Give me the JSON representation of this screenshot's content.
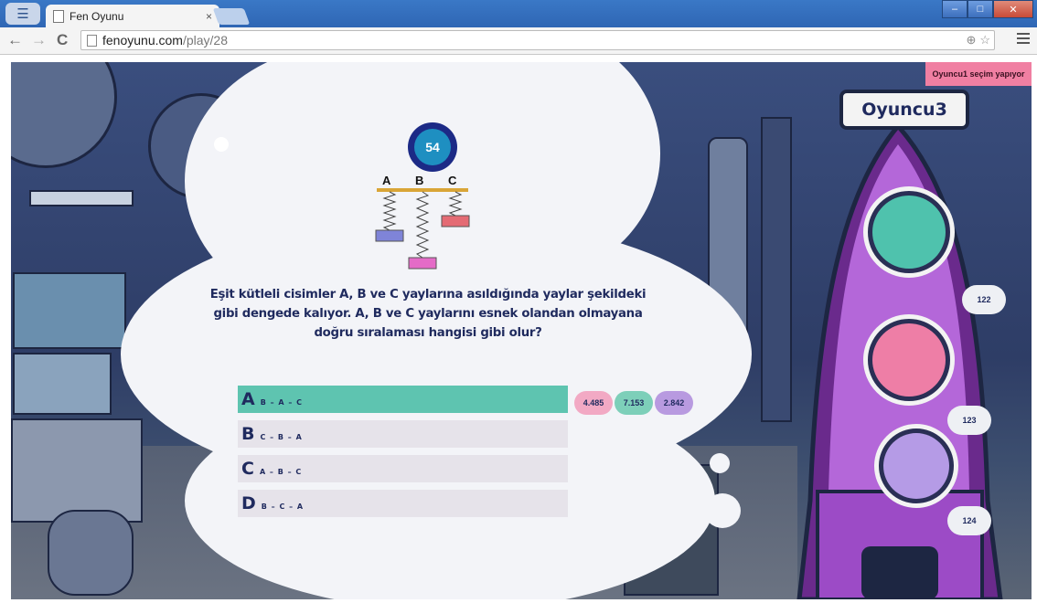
{
  "browser": {
    "tab_title": "Fen Oyunu",
    "tab_close": "×",
    "url_host": "fenoyunu.com",
    "url_path": "/play/28",
    "back_icon": "←",
    "forward_icon": "→",
    "reload_icon": "C",
    "zoom_icon": "⊕",
    "star_icon": "☆"
  },
  "game": {
    "status_banner": "Oyuncu1 seçim yapıyor",
    "timer": "54",
    "spring_labels": [
      "A",
      "B",
      "C"
    ],
    "question": "Eşit kütleli cisimler A, B ve C yaylarına asıldığında yaylar şekildeki gibi dengede kalıyor. A, B ve C yaylarını esnek olandan olmayana doğru sıralaması hangisi gibi olur?",
    "answers": [
      {
        "letter": "A",
        "text": "B – A – C",
        "selected": true
      },
      {
        "letter": "B",
        "text": "C – B – A",
        "selected": false
      },
      {
        "letter": "C",
        "text": "A – B – C",
        "selected": false
      },
      {
        "letter": "D",
        "text": "B – C – A",
        "selected": false
      }
    ],
    "answer_stats": [
      {
        "value": "4.485",
        "color": "#f2a9c4"
      },
      {
        "value": "7.153",
        "color": "#7dcfb9"
      },
      {
        "value": "2.842",
        "color": "#b89ae0"
      }
    ],
    "player_name": "Oyuncu3",
    "players": [
      {
        "score": "122",
        "ring_color": "#4fc2ad"
      },
      {
        "score": "123",
        "ring_color": "#ee7ea6"
      },
      {
        "score": "124",
        "ring_color": "#b59be6"
      }
    ],
    "colors": {
      "accent_selected": "#5ec4b0",
      "answer_bg": "#e6e3ea",
      "text_dark": "#1f2a5e",
      "rocket": "#b467d9",
      "banner": "#f07fa2"
    }
  }
}
